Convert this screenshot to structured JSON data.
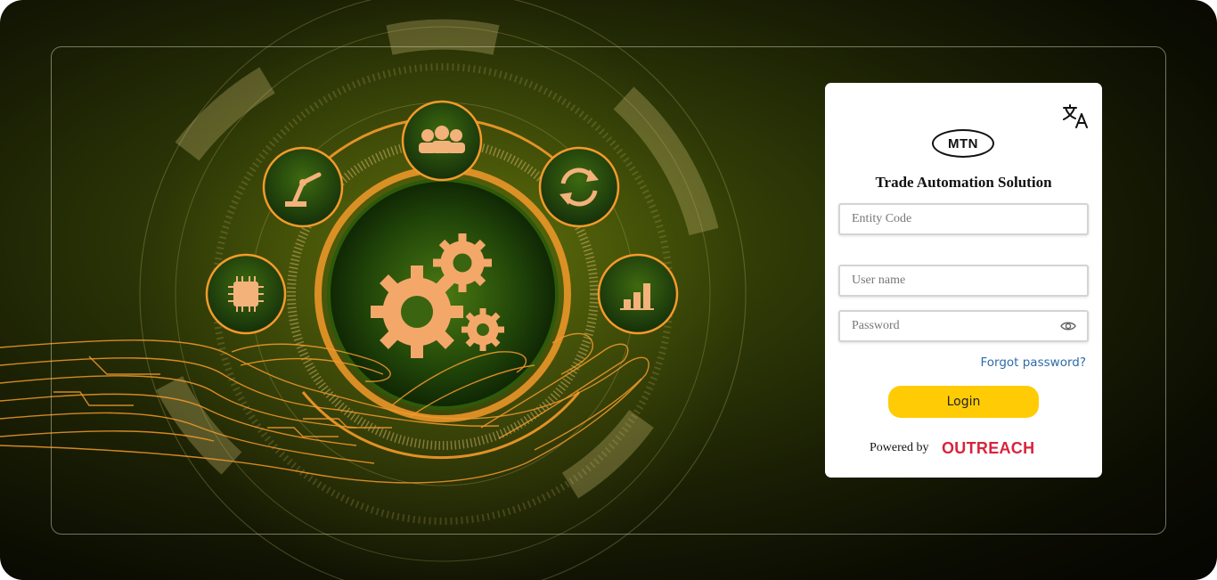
{
  "hero": {
    "icons": [
      "people-icon",
      "robot-arm-icon",
      "refresh-icon",
      "chip-icon",
      "bar-chart-icon",
      "gears-icon",
      "circuit-hand"
    ]
  },
  "login": {
    "brand_logo_text": "MTN",
    "title": "Trade Automation Solution",
    "entity_code_placeholder": "Entity Code",
    "username_placeholder": "User name",
    "password_placeholder": "Password",
    "forgot_password": "Forgot password?",
    "login_button": "Login",
    "powered_by": "Powered by",
    "powered_by_logo_text": "OUTREACH"
  },
  "colors": {
    "accent_yellow": "#ffcb05",
    "link_blue": "#2e6ba8",
    "outreach_red": "#d8233a",
    "hero_orange": "#f59a2a"
  }
}
